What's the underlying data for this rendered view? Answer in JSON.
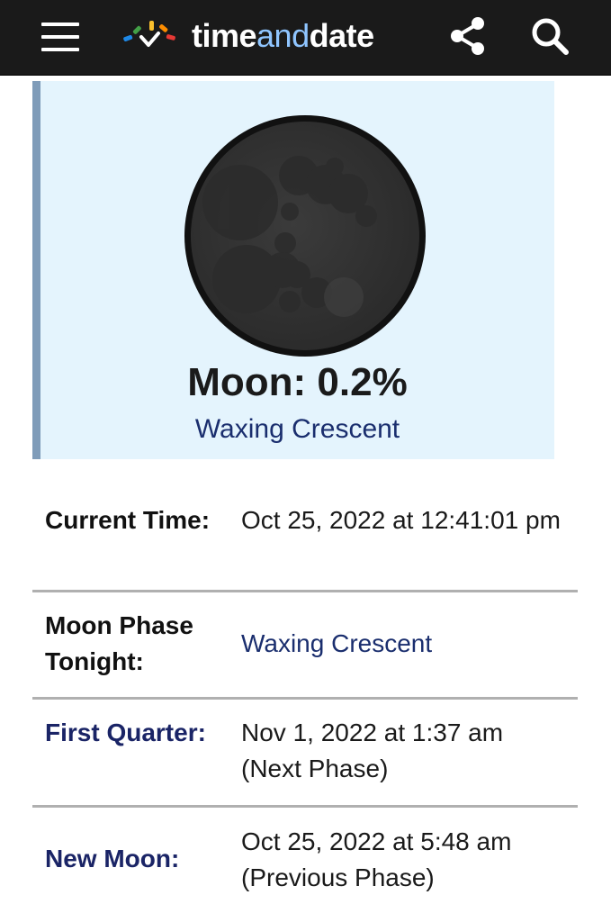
{
  "header": {
    "logo_text_1": "time",
    "logo_text_2": "and",
    "logo_text_3": "date",
    "icons": [
      "menu-icon",
      "share-icon",
      "search-icon"
    ]
  },
  "moon": {
    "title": "Moon: 0.2%",
    "phase": "Waxing Crescent"
  },
  "rows": [
    {
      "label": "Current Time:",
      "value": "Oct 25, 2022 at 12:41:01 pm"
    },
    {
      "label": "Moon Phase Tonight:",
      "value": "Waxing Crescent"
    },
    {
      "label": "First Quarter:",
      "value_1": "Nov 1, 2022 at 1:37 am",
      "value_2": "(Next Phase)"
    },
    {
      "label": "New Moon:",
      "value_1": "Oct 25, 2022 at 5:48 am",
      "value_2": "(Previous Phase)"
    }
  ],
  "colors": {
    "header_bg": "#1a1a1a",
    "card_bg": "#e4f4fd",
    "card_border": "#7f9cb9",
    "link": "#1a2e6e"
  }
}
